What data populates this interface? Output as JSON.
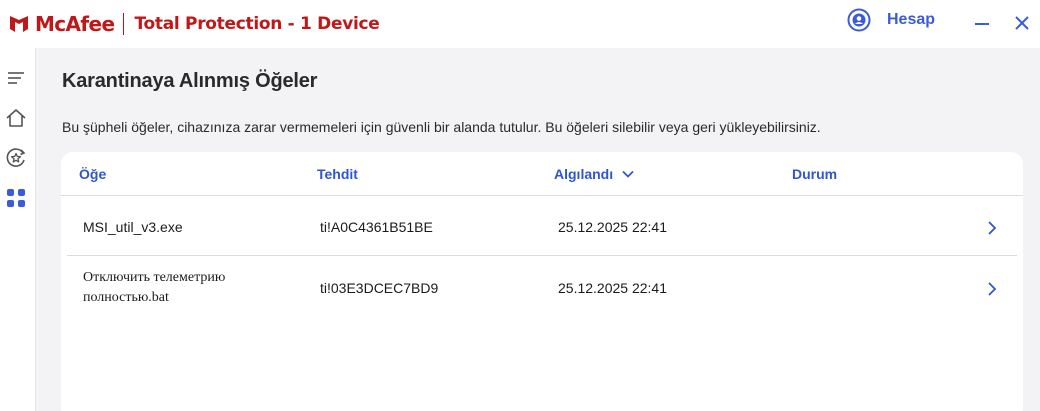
{
  "app": {
    "brand": "McAfee",
    "product": "Total Protection - 1 Device",
    "account_label": "Hesap",
    "brand_color": "#c01818",
    "accent_color": "#2f55d4"
  },
  "sidebar": {
    "items": [
      {
        "icon": "menu-icon"
      },
      {
        "icon": "home-icon"
      },
      {
        "icon": "protection-icon"
      },
      {
        "icon": "apps-grid-icon",
        "active": true
      }
    ]
  },
  "page": {
    "title": "Karantinaya Alınmış Öğeler",
    "description": "Bu şüpheli öğeler, cihazınıza zarar vermemeleri için güvenli bir alanda tutulur. Bu öğeleri silebilir veya geri yükleyebilirsiniz."
  },
  "table": {
    "columns": {
      "item": "Öğe",
      "threat": "Tehdit",
      "detected": "Algılandı",
      "status": "Durum"
    },
    "sort_column": "detected",
    "rows": [
      {
        "item": "MSI_util_v3.exe",
        "threat": "ti!A0C4361B51BE",
        "detected": "25.12.2025 22:41",
        "status": ""
      },
      {
        "item_line1": "Отключить телеметрию",
        "item_line2": "полностью.bat",
        "threat": "ti!03E3DCEC7BD9",
        "detected": "25.12.2025 22:41",
        "status": ""
      }
    ]
  }
}
